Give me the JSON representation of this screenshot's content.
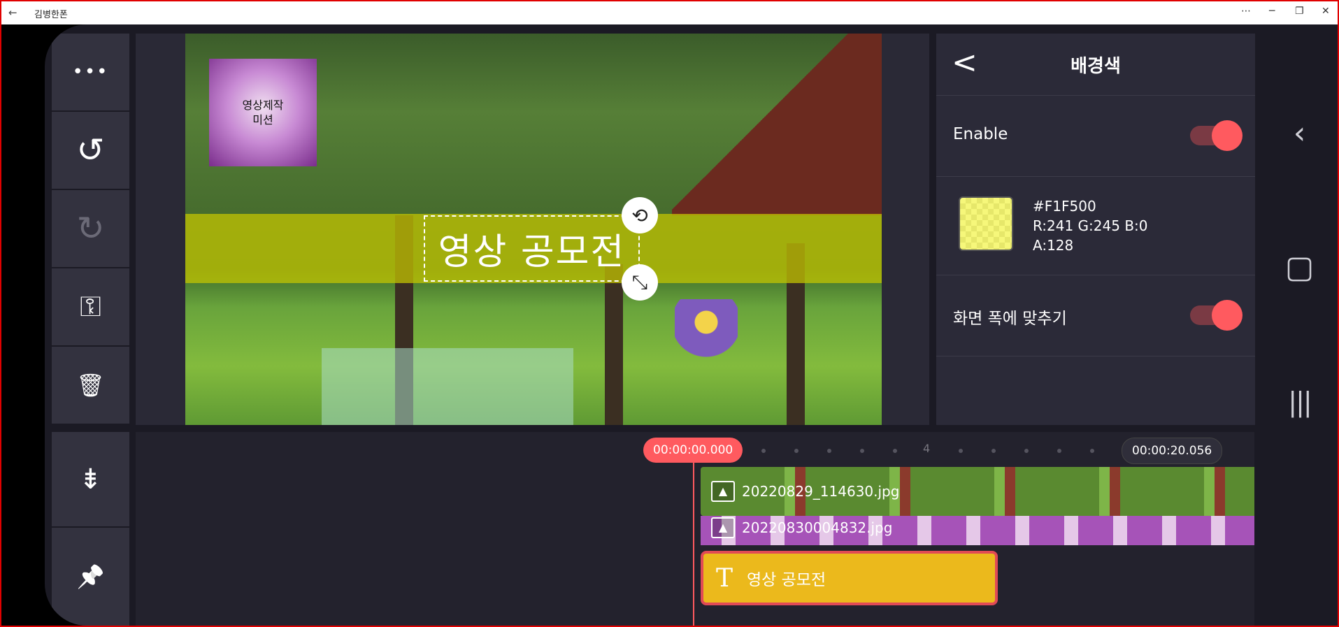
{
  "window": {
    "title": "김병한폰",
    "back_glyph": "←",
    "more_glyph": "⋯",
    "minimize_glyph": "─",
    "restore_glyph": "❐",
    "close_glyph": "✕"
  },
  "toolbar": {
    "more_glyph": "•••",
    "undo_glyph": "↺",
    "redo_glyph": "↻",
    "key_glyph": "⚿",
    "delete_glyph": "🗑",
    "split_glyph": "⇟",
    "pin_glyph": "📌"
  },
  "preview": {
    "thumbnail_text_line1": "영상제작",
    "thumbnail_text_line2": "미션",
    "caption_text": "영상 공모전",
    "rotate_glyph": "⟲",
    "resize_glyph": "⤡"
  },
  "panel": {
    "back_glyph": "<",
    "title": "배경색",
    "enable_label": "Enable",
    "enable_on": true,
    "color_hex": "#F1F500",
    "color_rgb": "R:241 G:245 B:0",
    "color_alpha": "A:128",
    "fit_label": "화면 폭에 맞추기",
    "fit_on": true
  },
  "timeline": {
    "start_time": "00:00:00.000",
    "end_time": "00:00:20.056",
    "tick_label": "4",
    "clips": [
      {
        "name": "20220829_114630.jpg"
      },
      {
        "name": "20220830004832.jpg"
      }
    ],
    "text_clip": "영상 공모전"
  },
  "nav": {
    "back_glyph": "‹",
    "home_glyph": "▢",
    "recent_glyph": "|||"
  },
  "colors": {
    "accent": "#ff5a5f",
    "text_clip": "#ebb91c",
    "band": "#c8c800"
  }
}
